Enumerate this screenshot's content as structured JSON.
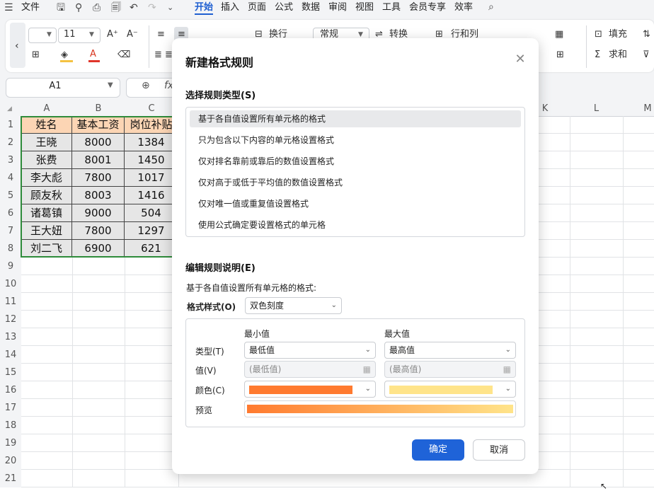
{
  "menu": {
    "file": "文件",
    "tabs": [
      "开始",
      "插入",
      "页面",
      "公式",
      "数据",
      "审阅",
      "视图",
      "工具",
      "会员专享",
      "效率"
    ],
    "active_tab": "开始"
  },
  "ribbon": {
    "font_size": "11",
    "wrap": "换行",
    "number_format": "常规",
    "convert": "转换",
    "rows_cols": "行和列",
    "fill": "填充",
    "sum": "求和"
  },
  "formula_bar": {
    "name_box": "A1",
    "fx": "fx"
  },
  "sheet": {
    "columns": [
      "A",
      "B",
      "C",
      "K",
      "L",
      "M"
    ],
    "rows": [
      "1",
      "2",
      "3",
      "4",
      "5",
      "6",
      "7",
      "8",
      "9",
      "10",
      "11",
      "12",
      "13",
      "14",
      "15",
      "16",
      "17",
      "18",
      "19",
      "20",
      "21"
    ],
    "table": [
      [
        "姓名",
        "基本工资",
        "岗位补贴"
      ],
      [
        "王晓",
        "8000",
        "1384"
      ],
      [
        "张费",
        "8001",
        "1450"
      ],
      [
        "李大彪",
        "7800",
        "1017"
      ],
      [
        "顾友秋",
        "8003",
        "1416"
      ],
      [
        "诸葛镇",
        "9000",
        "504"
      ],
      [
        "王大妞",
        "7800",
        "1297"
      ],
      [
        "刘二飞",
        "6900",
        "621"
      ]
    ]
  },
  "dialog": {
    "title": "新建格式规则",
    "rule_type_label": "选择规则类型(S)",
    "rule_types": [
      "基于各自值设置所有单元格的格式",
      "只为包含以下内容的单元格设置格式",
      "仅对排名靠前或靠后的数值设置格式",
      "仅对高于或低于平均值的数值设置格式",
      "仅对唯一值或重复值设置格式",
      "使用公式确定要设置格式的单元格"
    ],
    "selected_rule_index": 0,
    "edit_label": "编辑规则说明(E)",
    "edit_desc": "基于各自值设置所有单元格的格式:",
    "format_style_label": "格式样式(O)",
    "format_style_value": "双色刻度",
    "min_header": "最小值",
    "max_header": "最大值",
    "type_label": "类型(T)",
    "value_label": "值(V)",
    "color_label": "颜色(C)",
    "preview_label": "预览",
    "min_type": "最低值",
    "max_type": "最高值",
    "min_value_placeholder": "(最低值)",
    "max_value_placeholder": "(最高值)",
    "min_color": "#ff7a2f",
    "max_color": "#ffe48a",
    "ok": "确定",
    "cancel": "取消"
  }
}
